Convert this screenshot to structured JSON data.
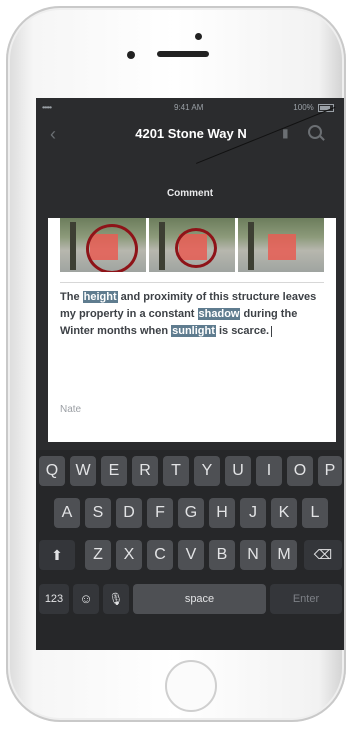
{
  "status_bar": {
    "signal": "•••••",
    "time": "9:41 AM",
    "battery": "100%"
  },
  "nav": {
    "title": "4201 Stone Way N"
  },
  "modal": {
    "title": "Comment"
  },
  "comment": {
    "parts": [
      {
        "text": "The ",
        "highlight": false
      },
      {
        "text": "height",
        "highlight": true
      },
      {
        "text": " and proximity of this structure leaves my property in a constant ",
        "highlight": false
      },
      {
        "text": "shadow",
        "highlight": true
      },
      {
        "text": " during the Winter months when ",
        "highlight": false
      },
      {
        "text": "sunlight",
        "highlight": true
      },
      {
        "text": " is scarce.",
        "highlight": false
      }
    ],
    "name_placeholder": "Nate"
  },
  "keyboard": {
    "row1": [
      "Q",
      "W",
      "E",
      "R",
      "T",
      "Y",
      "U",
      "I",
      "O",
      "P"
    ],
    "row2": [
      "A",
      "S",
      "D",
      "F",
      "G",
      "H",
      "J",
      "K",
      "L"
    ],
    "row3": [
      "Z",
      "X",
      "C",
      "V",
      "B",
      "N",
      "M"
    ],
    "numbers_label": "123",
    "space_label": "space",
    "enter_label": "Enter"
  },
  "colors": {
    "highlight": "#5f7c8f",
    "circle_marks": "#8e1318",
    "screen_bg": "#2b2c2e"
  }
}
